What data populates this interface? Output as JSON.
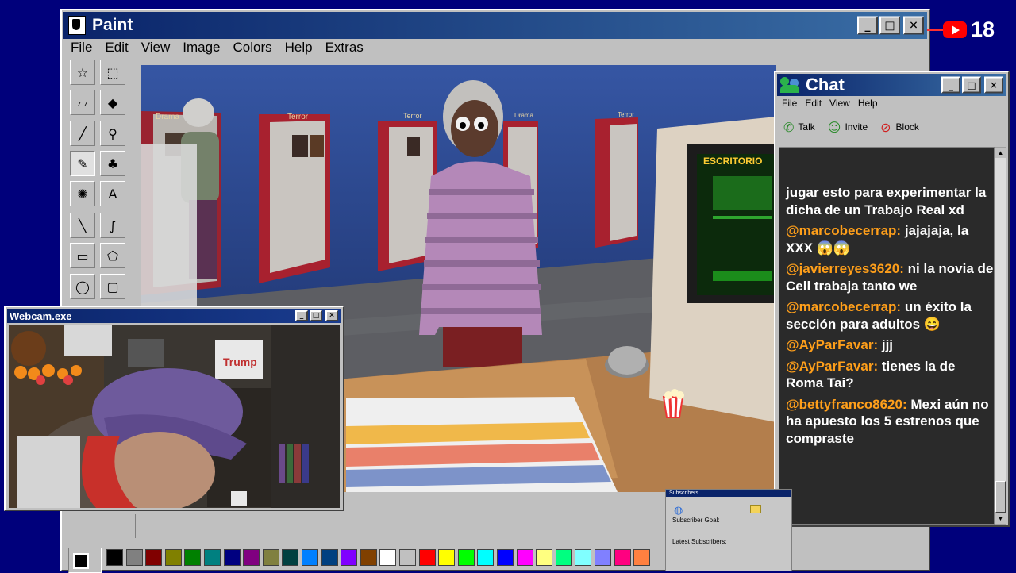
{
  "colors": {
    "desktop": "#00007b",
    "title_active": "#0a246a",
    "chat_bg": "#2a2a2a",
    "username": "#ff9f1a",
    "yt_red": "#ff0000"
  },
  "paint": {
    "title": "Paint",
    "menu": [
      "File",
      "Edit",
      "View",
      "Image",
      "Colors",
      "Help",
      "Extras"
    ],
    "window_buttons": {
      "minimize": "_",
      "maximize": "□",
      "close": "✕"
    },
    "tools": [
      {
        "name": "free-select-icon",
        "glyph": "☆"
      },
      {
        "name": "rect-select-icon",
        "glyph": "⬚"
      },
      {
        "name": "eraser-icon",
        "glyph": "▱"
      },
      {
        "name": "fill-bucket-icon",
        "glyph": "◆"
      },
      {
        "name": "color-picker-icon",
        "glyph": "╱"
      },
      {
        "name": "magnifier-icon",
        "glyph": "⚲"
      },
      {
        "name": "pencil-icon",
        "glyph": "✎"
      },
      {
        "name": "brush-icon",
        "glyph": "♣"
      },
      {
        "name": "airbrush-icon",
        "glyph": "✺"
      },
      {
        "name": "text-tool-icon",
        "glyph": "A"
      },
      {
        "name": "line-tool-icon",
        "glyph": "╲"
      },
      {
        "name": "curve-tool-icon",
        "glyph": "∫"
      },
      {
        "name": "rectangle-tool-icon",
        "glyph": "▭"
      },
      {
        "name": "polygon-tool-icon",
        "glyph": "⬠"
      },
      {
        "name": "ellipse-tool-icon",
        "glyph": "◯"
      },
      {
        "name": "rounded-rect-tool-icon",
        "glyph": "▢"
      }
    ],
    "palette": [
      "#000000",
      "#808080",
      "#800000",
      "#808000",
      "#008000",
      "#008080",
      "#000080",
      "#800080",
      "#808040",
      "#004040",
      "#0080ff",
      "#004080",
      "#8000ff",
      "#804000",
      "#ffffff",
      "#c0c0c0",
      "#ff0000",
      "#ffff00",
      "#00ff00",
      "#00ffff",
      "#0000ff",
      "#ff00ff",
      "#ffff80",
      "#00ff80",
      "#80ffff",
      "#8080ff",
      "#ff0080",
      "#ff8040"
    ],
    "current_color": "#000000"
  },
  "game": {
    "shelf_labels": [
      "Drama",
      "Terror",
      "Terror",
      "Drama",
      "Terror"
    ],
    "monitor_text": "ESCRITORIO"
  },
  "webcam": {
    "title": "Webcam.exe",
    "box_label": "Trump"
  },
  "chat": {
    "title": "Chat",
    "menu": [
      "File",
      "Edit",
      "View",
      "Help"
    ],
    "toolbar": {
      "talk": "Talk",
      "invite": "Invite",
      "block": "Block"
    },
    "messages": [
      {
        "user": "",
        "text": "jugar esto para experimentar la dicha de un Trabajo Real xd"
      },
      {
        "user": "@marcobecerrap:",
        "text": "jajajaja, la XXX 😱😱"
      },
      {
        "user": "@javierreyes3620:",
        "text": "ni la novia de Cell trabaja tanto we"
      },
      {
        "user": "@marcobecerrap:",
        "text": "un éxito la sección para adultos 😄"
      },
      {
        "user": "@AyParFavar:",
        "text": "jjj"
      },
      {
        "user": "@AyParFavar:",
        "text": "tienes la de Roma Tai?"
      },
      {
        "user": "@bettyfranco8620:",
        "text": "Mexi aún no ha apuesto los 5 estrenos que compraste"
      }
    ]
  },
  "subscribers": {
    "title": "Subscribers",
    "goal_label": "Subscriber Goal:",
    "latest_label": "Latest Subscribers:"
  },
  "youtube": {
    "count": "18"
  }
}
